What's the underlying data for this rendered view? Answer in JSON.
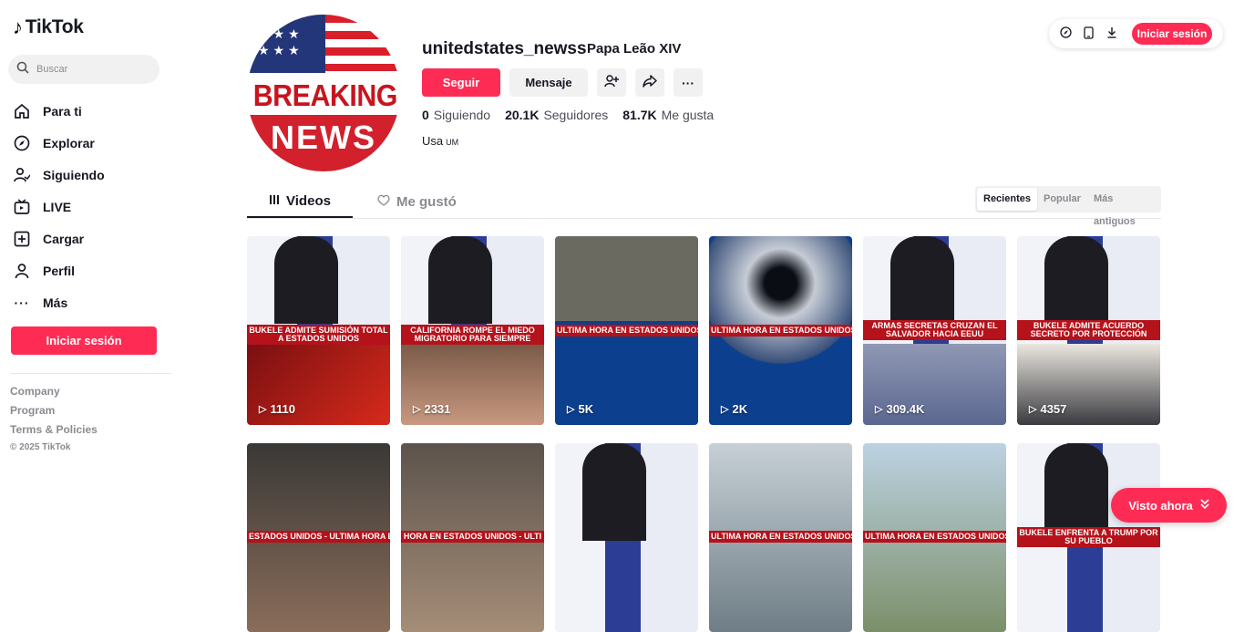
{
  "brand": {
    "name": "TikTok",
    "accent": "#fe2c55"
  },
  "sidebar": {
    "search_placeholder": "Buscar",
    "items": [
      {
        "label": "Para ti",
        "icon": "home-icon"
      },
      {
        "label": "Explorar",
        "icon": "compass-icon"
      },
      {
        "label": "Siguiendo",
        "icon": "following-icon"
      },
      {
        "label": "LIVE",
        "icon": "live-icon"
      },
      {
        "label": "Cargar",
        "icon": "upload-icon"
      },
      {
        "label": "Perfil",
        "icon": "profile-icon"
      },
      {
        "label": "Más",
        "icon": "more-icon"
      }
    ],
    "login_label": "Iniciar sesión",
    "footer_links": [
      "Company",
      "Program",
      "Terms & Policies"
    ],
    "copyright": "© 2025 TikTok"
  },
  "topbar": {
    "login_label": "Iniciar sesión"
  },
  "profile": {
    "avatar_text": {
      "top": "BREAKING",
      "bottom": "NEWS"
    },
    "username": "unitedstates_newss",
    "nickname": "Papa Leão XIV",
    "follow_label": "Seguir",
    "message_label": "Mensaje",
    "stats": [
      {
        "value": "0",
        "label": "Siguiendo"
      },
      {
        "value": "20.1K",
        "label": "Seguidores"
      },
      {
        "value": "81.7K",
        "label": "Me gusta"
      }
    ],
    "bio": "Usa",
    "bio_small": "UM"
  },
  "tabs": {
    "videos": "Videos",
    "liked": "Me gustó"
  },
  "sort": {
    "options": [
      "Recientes",
      "Popular",
      "Más antiguos"
    ],
    "active": "Recientes"
  },
  "videos": [
    {
      "caption": "BUKELE ADMITE SUMISIÓN TOTAL A ESTADOS UNIDOS",
      "views": "1110"
    },
    {
      "caption": "CALIFORNIA ROMPE EL MIEDO MIGRATORIO PARA SIEMPRE",
      "views": "2331"
    },
    {
      "caption": "ULTIMA HORA EN ESTADOS UNIDOS -",
      "views": "5K"
    },
    {
      "caption": "ULTIMA HORA EN ESTADOS UNIDOS -",
      "views": "2K"
    },
    {
      "caption": "ARMAS SECRETAS CRUZAN EL SALVADOR HACIA EEUU",
      "views": "309.4K"
    },
    {
      "caption": "BUKELE ADMITE ACUERDO SECRETO POR PROTECCIÓN",
      "views": "4357"
    },
    {
      "caption": "ESTADOS UNIDOS - ULTIMA HORA EN",
      "views": ""
    },
    {
      "caption": "HORA EN ESTADOS UNIDOS - ULTI",
      "views": ""
    },
    {
      "caption": "",
      "views": ""
    },
    {
      "caption": "ULTIMA HORA EN ESTADOS UNIDOS",
      "views": ""
    },
    {
      "caption": "ULTIMA HORA EN ESTADOS UNIDOS",
      "views": ""
    },
    {
      "caption": "BUKELE ENFRENTA A TRUMP POR SU PUEBLO",
      "views": ""
    }
  ],
  "visto_label": "Visto ahora"
}
